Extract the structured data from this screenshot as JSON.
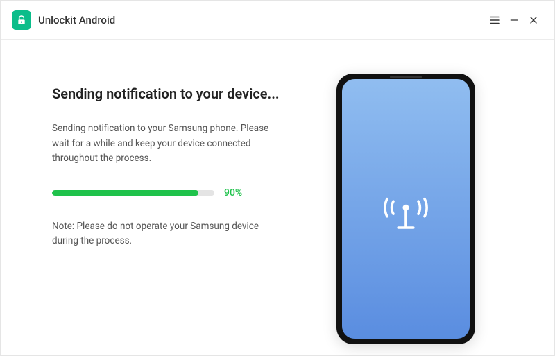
{
  "app": {
    "title": "Unlockit Android"
  },
  "main": {
    "heading": "Sending notification to your device...",
    "description": "Sending notification to your Samsung phone. Please wait for a while and keep your device connected throughout the process.",
    "progress": {
      "percent": 90,
      "label": "90%"
    },
    "note": "Note: Please do not operate your Samsung device during the process."
  },
  "colors": {
    "accent_green": "#1fc24b",
    "brand_green": "#0bbd8a",
    "phone_gradient_top": "#90bdf0",
    "phone_gradient_bottom": "#5a8de0"
  }
}
